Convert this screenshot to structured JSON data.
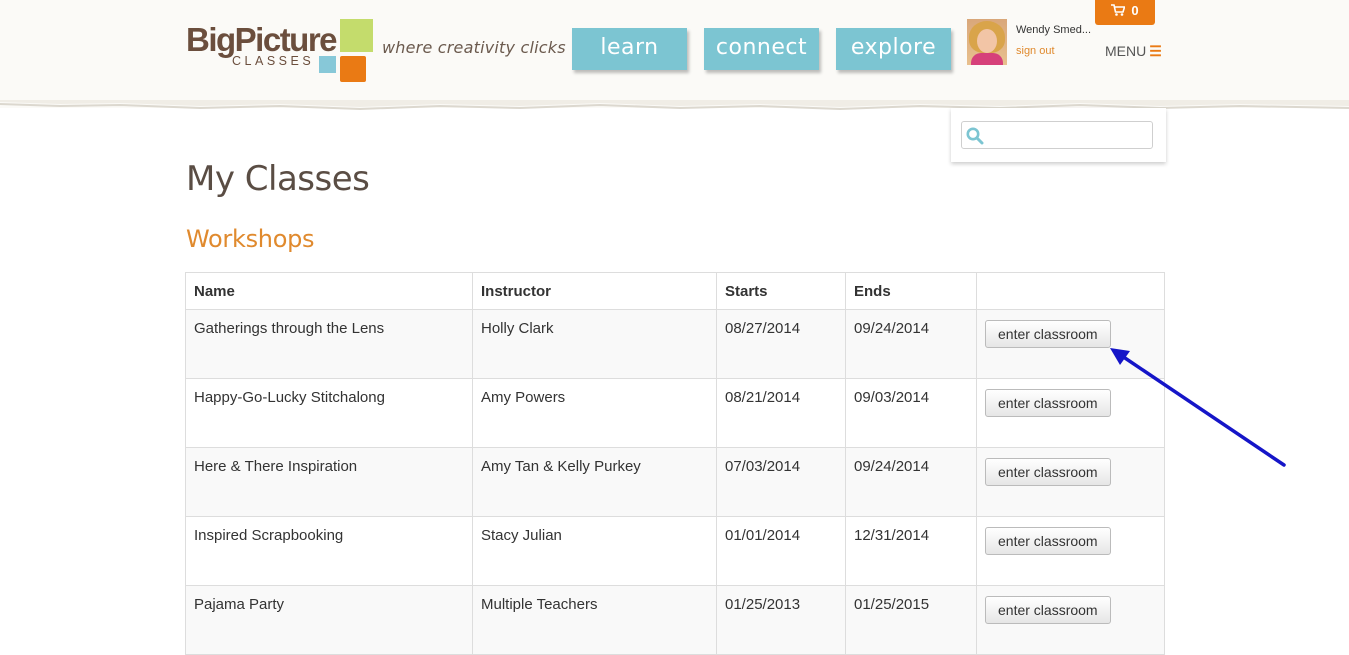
{
  "header": {
    "logo": {
      "big": "BigPicture",
      "small": "CLASSES"
    },
    "tagline": "where creativity clicks",
    "nav": [
      {
        "label": "learn"
      },
      {
        "label": "connect"
      },
      {
        "label": "explore"
      }
    ],
    "user": {
      "name": "Wendy Smed...",
      "sign_out": "sign out"
    },
    "menu": {
      "label": "MENU",
      "icon": "hamburger-icon"
    },
    "cart": {
      "icon": "cart-icon",
      "count": "0"
    },
    "search": {
      "placeholder": "",
      "icon": "search-icon"
    }
  },
  "colors": {
    "brown": "#6b4e3d",
    "orange": "#ea7a14",
    "teal": "#7cc5d2",
    "green": "#c4dc6c",
    "arrow": "#1515c8"
  },
  "main": {
    "title": "My Classes",
    "section": "Workshops",
    "table": {
      "headers": [
        "Name",
        "Instructor",
        "Starts",
        "Ends",
        ""
      ],
      "button_label": "enter classroom",
      "rows": [
        {
          "name": "Gatherings through the Lens",
          "instructor": "Holly Clark",
          "starts": "08/27/2014",
          "ends": "09/24/2014"
        },
        {
          "name": "Happy-Go-Lucky Stitchalong",
          "instructor": "Amy Powers",
          "starts": "08/21/2014",
          "ends": "09/03/2014"
        },
        {
          "name": "Here & There Inspiration",
          "instructor": "Amy Tan & Kelly Purkey",
          "starts": "07/03/2014",
          "ends": "09/24/2014"
        },
        {
          "name": "Inspired Scrapbooking",
          "instructor": "Stacy Julian",
          "starts": "01/01/2014",
          "ends": "12/31/2014"
        },
        {
          "name": "Pajama Party",
          "instructor": "Multiple Teachers",
          "starts": "01/25/2013",
          "ends": "01/25/2015"
        }
      ]
    }
  }
}
